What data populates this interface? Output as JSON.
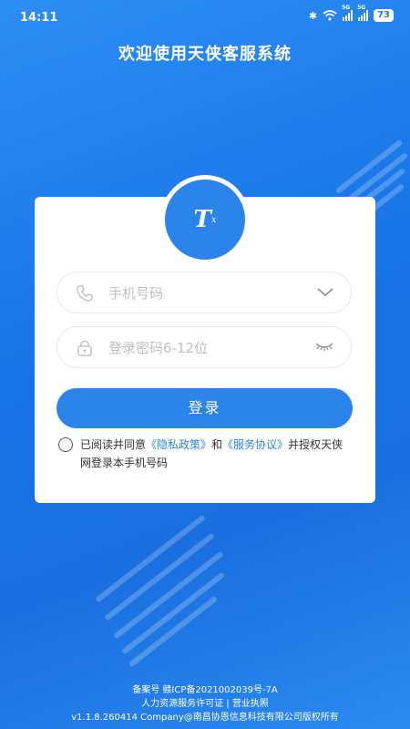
{
  "status_bar": {
    "time": "14:11",
    "battery": "73",
    "signal_tag": "5G"
  },
  "header": {
    "title": "欢迎使用天侠客服系统"
  },
  "logo": {
    "main": "T",
    "sub": "x"
  },
  "login_form": {
    "phone_placeholder": "手机号码",
    "password_placeholder": "登录密码6-12位",
    "submit_label": "登录"
  },
  "agreement": {
    "prefix": "已阅读并同意",
    "privacy_link": "《隐私政策》",
    "and": "和",
    "service_link": "《服务协议》",
    "suffix": "并授权天侠网登录本手机号码"
  },
  "footer": {
    "icp": "备案号 赣ICP备2021002039号-7A",
    "licenses": "人力资源服务许可证 | 营业执照",
    "version": "v1.1.8.260414 Company@南昌协恩信息科技有限公司版权所有"
  },
  "colors": {
    "primary": "#2b84ea",
    "background": "#1e7bea"
  }
}
